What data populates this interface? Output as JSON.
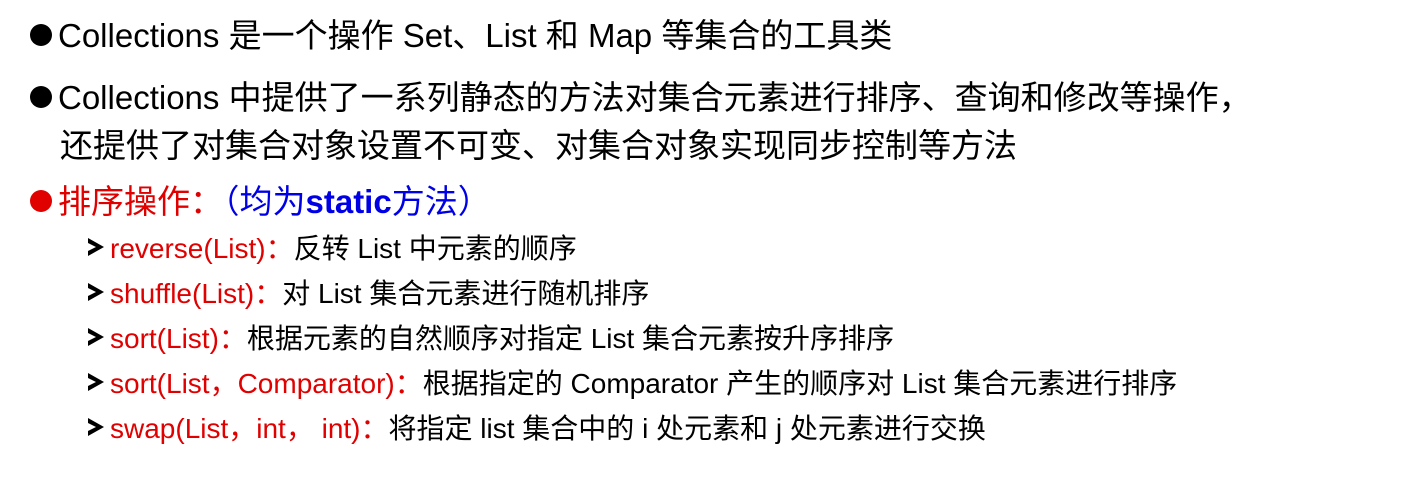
{
  "bullets": [
    {
      "text": "Collections 是一个操作 Set、List 和 Map 等集合的工具类"
    },
    {
      "text_line1": "Collections 中提供了一系列静态的方法对集合元素进行排序、查询和修改等操作，",
      "text_line2": "还提供了对集合对象设置不可变、对集合对象实现同步控制等方法"
    }
  ],
  "section": {
    "title": "排序操作",
    "colon": "：",
    "note_open": "（均为",
    "note_keyword": "static",
    "note_close": "方法）"
  },
  "methods": [
    {
      "signature": "reverse(List)",
      "sep": "：",
      "description": "反转 List 中元素的顺序"
    },
    {
      "signature": "shuffle(List)",
      "sep": "：",
      "description": "对 List 集合元素进行随机排序"
    },
    {
      "signature": "sort(List)",
      "sep": "：",
      "description": "根据元素的自然顺序对指定 List 集合元素按升序排序"
    },
    {
      "signature": "sort(List，Comparator)",
      "sep": "：",
      "description": "根据指定的 Comparator 产生的顺序对 List 集合元素进行排序"
    },
    {
      "signature": "swap(List，int， int)",
      "sep": "：",
      "description": "将指定 list 集合中的 i 处元素和 j 处元素进行交换"
    }
  ],
  "colors": {
    "bullet_black": "#000000",
    "accent_red": "#e00000",
    "accent_blue": "#0000e6"
  }
}
